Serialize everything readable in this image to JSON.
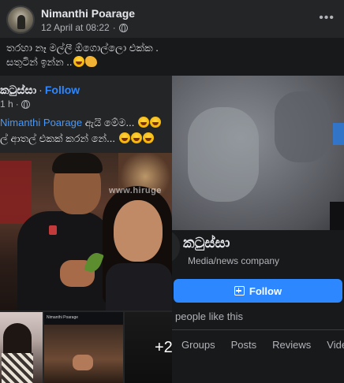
{
  "post": {
    "author": "Nimanthi Poarage",
    "timestamp": "12 April at 08:22",
    "more_label": "•••",
    "caption_line1": "තරහා නෑ මල්ලී ඕගොල්ලො එක්ක .",
    "caption_line2": "සතුටින් ඉන්න .."
  },
  "shared_post": {
    "page_name": "කටුස්සා",
    "dot": "·",
    "follow_label": "Follow",
    "time": "1 h",
    "mention": "Nimanthi Poarage",
    "text_after_mention": "ඇයි මේම...",
    "text_line2": "ල් ආතල් එකක් කරන් නේ...",
    "watermark": "www.hiruge",
    "more_photos": "+2",
    "mini_header": "Nimanthi Poarage"
  },
  "page_card": {
    "title": "කටුස්සා",
    "category": "Media/news company",
    "follow_label": "Follow",
    "likes_text": "people like this",
    "tabs": [
      {
        "label": "Groups"
      },
      {
        "label": "Posts"
      },
      {
        "label": "Reviews"
      },
      {
        "label": "Videos"
      }
    ]
  },
  "colors": {
    "background": "#18191a",
    "card": "#242526",
    "accent": "#2d88ff",
    "text_primary": "#e4e6eb",
    "text_secondary": "#b0b3b8"
  }
}
